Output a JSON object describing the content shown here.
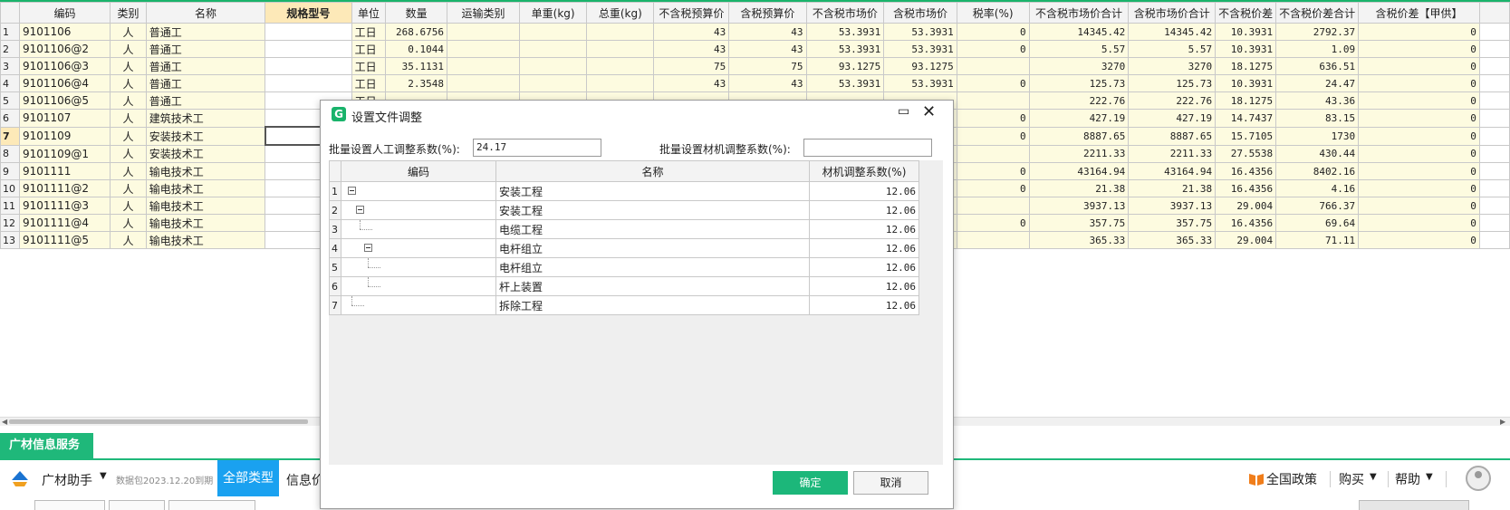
{
  "grid": {
    "columns": [
      "编码",
      "类别",
      "名称",
      "规格型号",
      "单位",
      "数量",
      "运输类别",
      "单重(kg)",
      "总重(kg)",
      "不含税预算价",
      "含税预算价",
      "不含税市场价",
      "含税市场价",
      "税率(%)",
      "不含税市场价合计",
      "含税市场价合计",
      "不含税价差",
      "不含税价差合计",
      "含税价差【甲供】"
    ],
    "rows": [
      {
        "n": "1",
        "code": "9101106",
        "cat": "人",
        "name": "普通工",
        "unit": "工日",
        "qty": "268.6756",
        "p1": "43",
        "p2": "43",
        "p3": "53.3931",
        "p4": "53.3931",
        "tax": "0",
        "t1": "14345.42",
        "t2": "14345.42",
        "d1": "10.3931",
        "d2": "2792.37",
        "d3": "0"
      },
      {
        "n": "2",
        "code": "9101106@2",
        "cat": "人",
        "name": "普通工",
        "unit": "工日",
        "qty": "0.1044",
        "p1": "43",
        "p2": "43",
        "p3": "53.3931",
        "p4": "53.3931",
        "tax": "0",
        "t1": "5.57",
        "t2": "5.57",
        "d1": "10.3931",
        "d2": "1.09",
        "d3": "0"
      },
      {
        "n": "3",
        "code": "9101106@3",
        "cat": "人",
        "name": "普通工",
        "unit": "工日",
        "qty": "35.1131",
        "p1": "75",
        "p2": "75",
        "p3": "93.1275",
        "p4": "93.1275",
        "tax": "",
        "t1": "3270",
        "t2": "3270",
        "d1": "18.1275",
        "d2": "636.51",
        "d3": "0"
      },
      {
        "n": "4",
        "code": "9101106@4",
        "cat": "人",
        "name": "普通工",
        "unit": "工日",
        "qty": "2.3548",
        "p1": "43",
        "p2": "43",
        "p3": "53.3931",
        "p4": "53.3931",
        "tax": "0",
        "t1": "125.73",
        "t2": "125.73",
        "d1": "10.3931",
        "d2": "24.47",
        "d3": "0"
      },
      {
        "n": "5",
        "code": "9101106@5",
        "cat": "人",
        "name": "普通工",
        "unit": "工日",
        "qty": "",
        "p1": "",
        "p2": "",
        "p3": "",
        "p4": "",
        "tax": "",
        "t1": "222.76",
        "t2": "222.76",
        "d1": "18.1275",
        "d2": "43.36",
        "d3": "0"
      },
      {
        "n": "6",
        "code": "9101107",
        "cat": "人",
        "name": "建筑技术工",
        "unit": "",
        "qty": "",
        "p1": "",
        "p2": "",
        "p3": "",
        "p4": "",
        "tax": "0",
        "t1": "427.19",
        "t2": "427.19",
        "d1": "14.7437",
        "d2": "83.15",
        "d3": "0"
      },
      {
        "n": "7",
        "code": "9101109",
        "cat": "人",
        "name": "安装技术工",
        "unit": "",
        "qty": "",
        "p1": "",
        "p2": "",
        "p3": "",
        "p4": "",
        "tax": "0",
        "t1": "8887.65",
        "t2": "8887.65",
        "d1": "15.7105",
        "d2": "1730",
        "d3": "0"
      },
      {
        "n": "8",
        "code": "9101109@1",
        "cat": "人",
        "name": "安装技术工",
        "unit": "",
        "qty": "",
        "p1": "",
        "p2": "",
        "p3": "",
        "p4": "",
        "tax": "",
        "t1": "2211.33",
        "t2": "2211.33",
        "d1": "27.5538",
        "d2": "430.44",
        "d3": "0"
      },
      {
        "n": "9",
        "code": "9101111",
        "cat": "人",
        "name": "输电技术工",
        "unit": "",
        "qty": "",
        "p1": "",
        "p2": "",
        "p3": "",
        "p4": "",
        "tax": "0",
        "t1": "43164.94",
        "t2": "43164.94",
        "d1": "16.4356",
        "d2": "8402.16",
        "d3": "0"
      },
      {
        "n": "10",
        "code": "9101111@2",
        "cat": "人",
        "name": "输电技术工",
        "unit": "",
        "qty": "",
        "p1": "",
        "p2": "",
        "p3": "",
        "p4": "",
        "tax": "0",
        "t1": "21.38",
        "t2": "21.38",
        "d1": "16.4356",
        "d2": "4.16",
        "d3": "0"
      },
      {
        "n": "11",
        "code": "9101111@3",
        "cat": "人",
        "name": "输电技术工",
        "unit": "",
        "qty": "",
        "p1": "",
        "p2": "",
        "p3": "",
        "p4": "",
        "tax": "",
        "t1": "3937.13",
        "t2": "3937.13",
        "d1": "29.004",
        "d2": "766.37",
        "d3": "0"
      },
      {
        "n": "12",
        "code": "9101111@4",
        "cat": "人",
        "name": "输电技术工",
        "unit": "",
        "qty": "",
        "p1": "",
        "p2": "",
        "p3": "",
        "p4": "",
        "tax": "0",
        "t1": "357.75",
        "t2": "357.75",
        "d1": "16.4356",
        "d2": "69.64",
        "d3": "0"
      },
      {
        "n": "13",
        "code": "9101111@5",
        "cat": "人",
        "name": "输电技术工",
        "unit": "",
        "qty": "",
        "p1": "",
        "p2": "",
        "p3": "",
        "p4": "",
        "tax": "",
        "t1": "365.33",
        "t2": "365.33",
        "d1": "29.004",
        "d2": "71.11",
        "d3": "0"
      }
    ]
  },
  "dialog": {
    "title": "设置文件调整",
    "app_icon_glyph": "G",
    "labor_label": "批量设置人工调整系数(%):",
    "labor_value": "24.17",
    "material_label": "批量设置材机调整系数(%):",
    "material_value": "",
    "tree_columns": [
      "编码",
      "名称",
      "材机调整系数(%)"
    ],
    "tree_rows": [
      {
        "n": "1",
        "name": "安装工程",
        "coef": "12.06"
      },
      {
        "n": "2",
        "name": "安装工程",
        "coef": "12.06"
      },
      {
        "n": "3",
        "name": "电缆工程",
        "coef": "12.06"
      },
      {
        "n": "4",
        "name": "电杆组立",
        "coef": "12.06"
      },
      {
        "n": "5",
        "name": "电杆组立",
        "coef": "12.06"
      },
      {
        "n": "6",
        "name": "杆上装置",
        "coef": "12.06"
      },
      {
        "n": "7",
        "name": "拆除工程",
        "coef": "12.06"
      }
    ],
    "ok_label": "确定",
    "cancel_label": "取消"
  },
  "service_tab": "广材信息服务",
  "bottombar": {
    "assistant": "广材助手",
    "package_info": "数据包2023.12.20到期",
    "all_types": "全部类型",
    "info_tab": "信息价",
    "policy": "全国政策",
    "buy": "购买",
    "help": "帮助"
  },
  "colors": {
    "accent": "#19b36b",
    "selected_blue": "#1aa1f0",
    "row_yellow": "#fdfbe0"
  }
}
